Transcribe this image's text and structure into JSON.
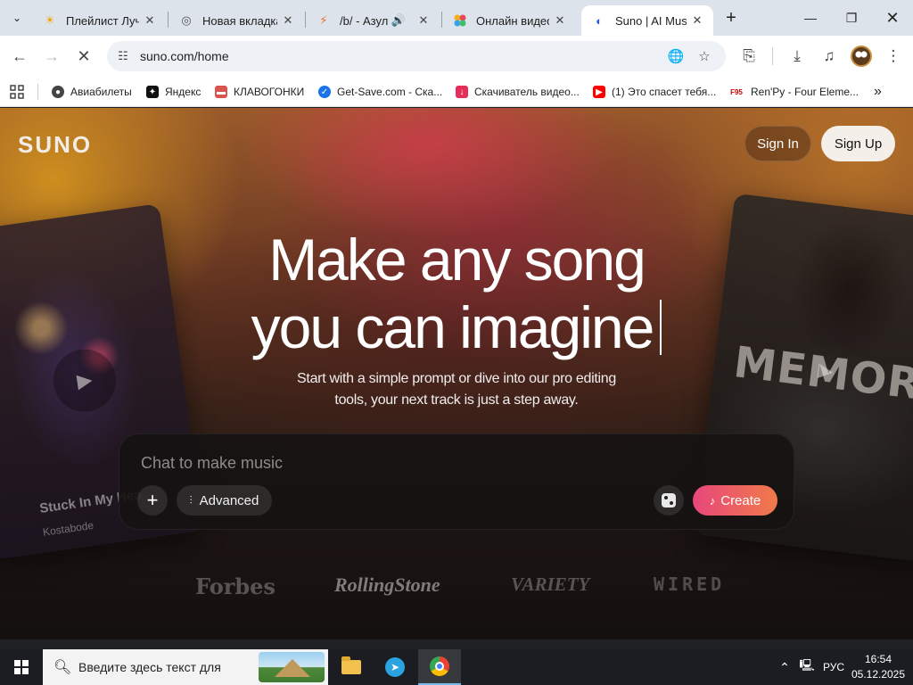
{
  "browser": {
    "tabs": [
      {
        "title": "Плейлист Лучш",
        "favicon": "sun-icon"
      },
      {
        "title": "Новая вкладка",
        "favicon": "chrome-icon"
      },
      {
        "title": "/b/ - Азула",
        "favicon": "bolt-icon",
        "audio": true
      },
      {
        "title": "Онлайн видео",
        "favicon": "dots-icon"
      },
      {
        "title": "Suno | AI Music",
        "favicon": "suno-icon",
        "active": true
      }
    ],
    "url": "suno.com/home",
    "bookmarks": [
      {
        "label": "Авиабилеты"
      },
      {
        "label": "Яндекс"
      },
      {
        "label": "КЛАВОГОНКИ"
      },
      {
        "label": "Get-Save.com - Ска..."
      },
      {
        "label": "Скачиватель видео..."
      },
      {
        "label": "(1) Это спасет тебя..."
      },
      {
        "label": "Ren'Py - Four Eleme..."
      }
    ],
    "bookmark_icon_text": {
      "f95": "F95"
    }
  },
  "page": {
    "logo": "SUNO",
    "sign_in": "Sign In",
    "sign_up": "Sign Up",
    "headline_line1": "Make any song",
    "headline_line2": "you can imagine",
    "subtitle_line1": "Start with a simple prompt or dive into our pro editing",
    "subtitle_line2": "tools, your next track is just a step away.",
    "composer": {
      "placeholder": "Chat to make music",
      "advanced_label": "Advanced",
      "create_label": "Create"
    },
    "card_left": {
      "title": "Stuck In My Hea",
      "artist": "Kostabode"
    },
    "card_right": {
      "art_text": "MEMORY"
    },
    "press_logos": [
      "Forbes",
      "RollingStone",
      "VARIETY",
      "WIRED"
    ]
  },
  "taskbar": {
    "search_placeholder": "Введите здесь текст для",
    "language": "РУС",
    "time": "16:54",
    "date": "05.12.2025"
  }
}
